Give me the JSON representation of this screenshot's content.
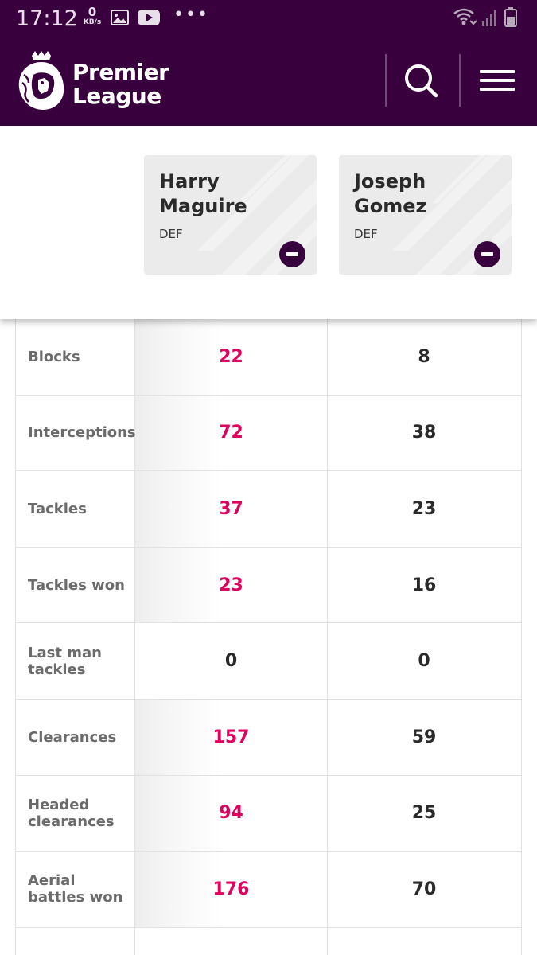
{
  "status_bar": {
    "time": "17:12",
    "net_speed_value": "0",
    "net_speed_unit": "KB/s",
    "left_icons": [
      "gallery-icon",
      "youtube-icon",
      "more-dots-icon"
    ],
    "right_icons": [
      "wifi-icon",
      "signal-icon",
      "battery-icon"
    ]
  },
  "header": {
    "brand_line1": "Premier",
    "brand_line2": "League",
    "bg_color": "#38003c",
    "icons": [
      "lion-logo-icon",
      "search-icon",
      "menu-icon"
    ]
  },
  "compare": {
    "players": [
      {
        "first_name": "Harry",
        "last_name": "Maguire",
        "position": "DEF"
      },
      {
        "first_name": "Joseph",
        "last_name": "Gomez",
        "position": "DEF"
      }
    ]
  },
  "stats": [
    {
      "label": "Blocks",
      "p1": "22",
      "p2": "8",
      "p1_wins": true
    },
    {
      "label": "Interceptions",
      "p1": "72",
      "p2": "38",
      "p1_wins": true
    },
    {
      "label": "Tackles",
      "p1": "37",
      "p2": "23",
      "p1_wins": true
    },
    {
      "label": "Tackles won",
      "p1": "23",
      "p2": "16",
      "p1_wins": true
    },
    {
      "label": "Last man tackles",
      "p1": "0",
      "p2": "0",
      "p1_wins": false
    },
    {
      "label": "Clearances",
      "p1": "157",
      "p2": "59",
      "p1_wins": true
    },
    {
      "label": "Headed clearances",
      "p1": "94",
      "p2": "25",
      "p1_wins": true
    },
    {
      "label": "Aerial battles won",
      "p1": "176",
      "p2": "70",
      "p1_wins": true
    }
  ],
  "colors": {
    "accent_win": "#e0005e",
    "brand_purple": "#38003c"
  }
}
